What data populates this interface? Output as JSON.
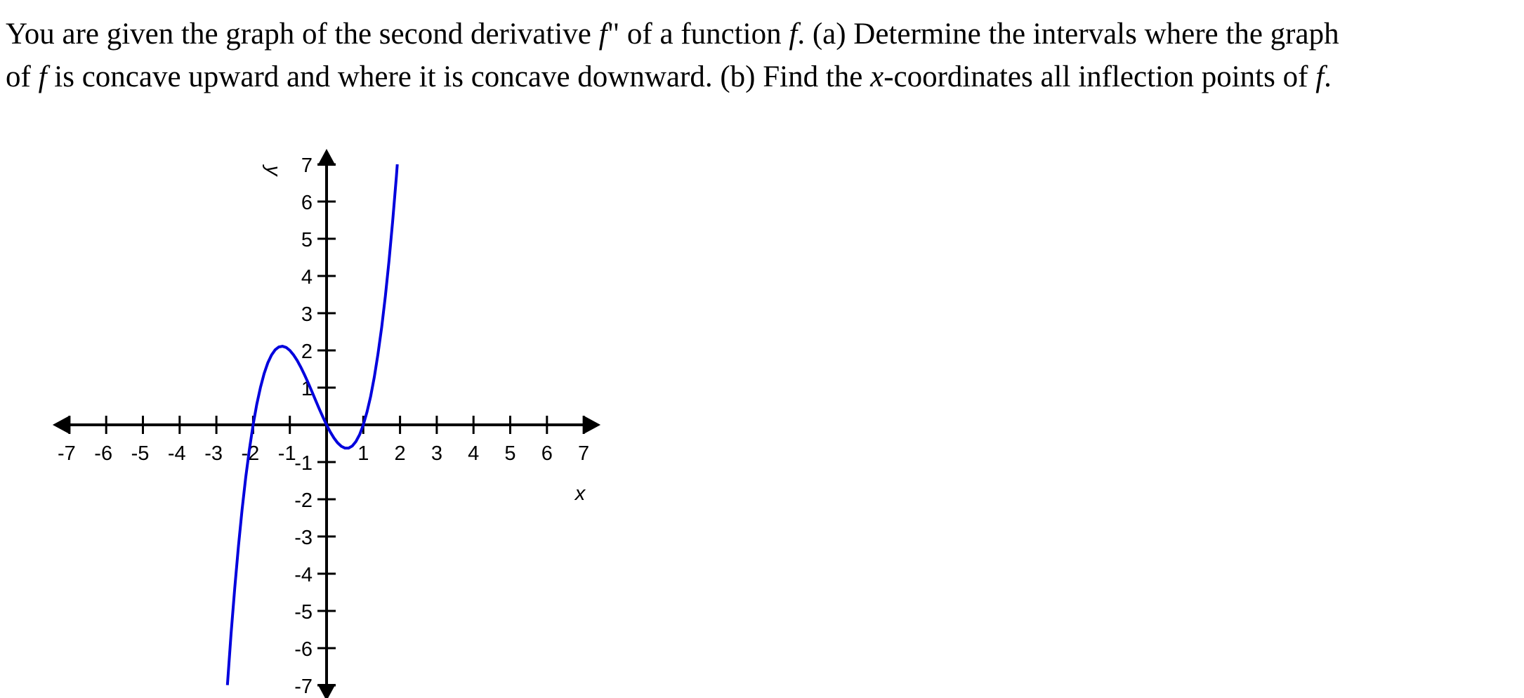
{
  "question": {
    "line1": [
      {
        "t": "You are given the graph of the second derivative ",
        "i": false
      },
      {
        "t": "f",
        "i": true
      },
      {
        "t": "\" of a function ",
        "i": false
      },
      {
        "t": "f",
        "i": true
      },
      {
        "t": ". (a) Determine the intervals where the graph",
        "i": false
      }
    ],
    "line2": [
      {
        "t": "of ",
        "i": false
      },
      {
        "t": "f",
        "i": true
      },
      {
        "t": " is concave upward and where it is concave downward. (b) Find the ",
        "i": false
      },
      {
        "t": "x",
        "i": true
      },
      {
        "t": "-coordinates all inflection points of ",
        "i": false
      },
      {
        "t": "f",
        "i": true
      },
      {
        "t": ".",
        "i": false
      }
    ]
  },
  "chart_data": {
    "type": "line",
    "title": "",
    "xlabel": "x",
    "ylabel": "y",
    "xlim": [
      -7,
      7
    ],
    "ylim": [
      -7,
      7
    ],
    "xticks": [
      "-7",
      "-6",
      "-5",
      "-4",
      "-3",
      "-2",
      "-1",
      "1",
      "2",
      "3",
      "4",
      "5",
      "6",
      "7"
    ],
    "yticks": [
      "7",
      "6",
      "5",
      "4",
      "3",
      "2",
      "1",
      "-1",
      "-2",
      "-3",
      "-4",
      "-5",
      "-6",
      "-7"
    ],
    "grid": false,
    "series_color": "#0000dd",
    "axis_color": "#000000",
    "points": [
      [
        -2.7,
        -6.993
      ],
      [
        -2.6,
        -5.616
      ],
      [
        -2.5,
        -4.375
      ],
      [
        -2.4,
        -3.264
      ],
      [
        -2.3,
        -2.277
      ],
      [
        -2.2,
        -1.408
      ],
      [
        -2.1,
        -0.651
      ],
      [
        -2.0,
        0
      ],
      [
        -1.9,
        0.551
      ],
      [
        -1.8,
        1.008
      ],
      [
        -1.7,
        1.377
      ],
      [
        -1.6,
        1.664
      ],
      [
        -1.5,
        1.875
      ],
      [
        -1.4,
        2.016
      ],
      [
        -1.3,
        2.093
      ],
      [
        -1.2,
        2.112
      ],
      [
        -1.1,
        2.079
      ],
      [
        -1.0,
        2.0
      ],
      [
        -0.9,
        1.881
      ],
      [
        -0.8,
        1.728
      ],
      [
        -0.7,
        1.547
      ],
      [
        -0.6,
        1.344
      ],
      [
        -0.5,
        1.125
      ],
      [
        -0.4,
        0.896
      ],
      [
        -0.3,
        0.663
      ],
      [
        -0.2,
        0.432
      ],
      [
        -0.1,
        0.209
      ],
      [
        0,
        0
      ],
      [
        0.1,
        -0.189
      ],
      [
        0.2,
        -0.352
      ],
      [
        0.3,
        -0.483
      ],
      [
        0.4,
        -0.576
      ],
      [
        0.5,
        -0.625
      ],
      [
        0.6,
        -0.624
      ],
      [
        0.7,
        -0.567
      ],
      [
        0.8,
        -0.448
      ],
      [
        0.9,
        -0.261
      ],
      [
        1.0,
        0
      ],
      [
        1.1,
        0.341
      ],
      [
        1.2,
        0.768
      ],
      [
        1.3,
        1.287
      ],
      [
        1.4,
        1.904
      ],
      [
        1.5,
        2.625
      ],
      [
        1.6,
        3.456
      ],
      [
        1.7,
        4.403
      ],
      [
        1.8,
        5.472
      ],
      [
        1.9,
        6.669
      ],
      [
        1.925,
        7.0
      ]
    ]
  }
}
